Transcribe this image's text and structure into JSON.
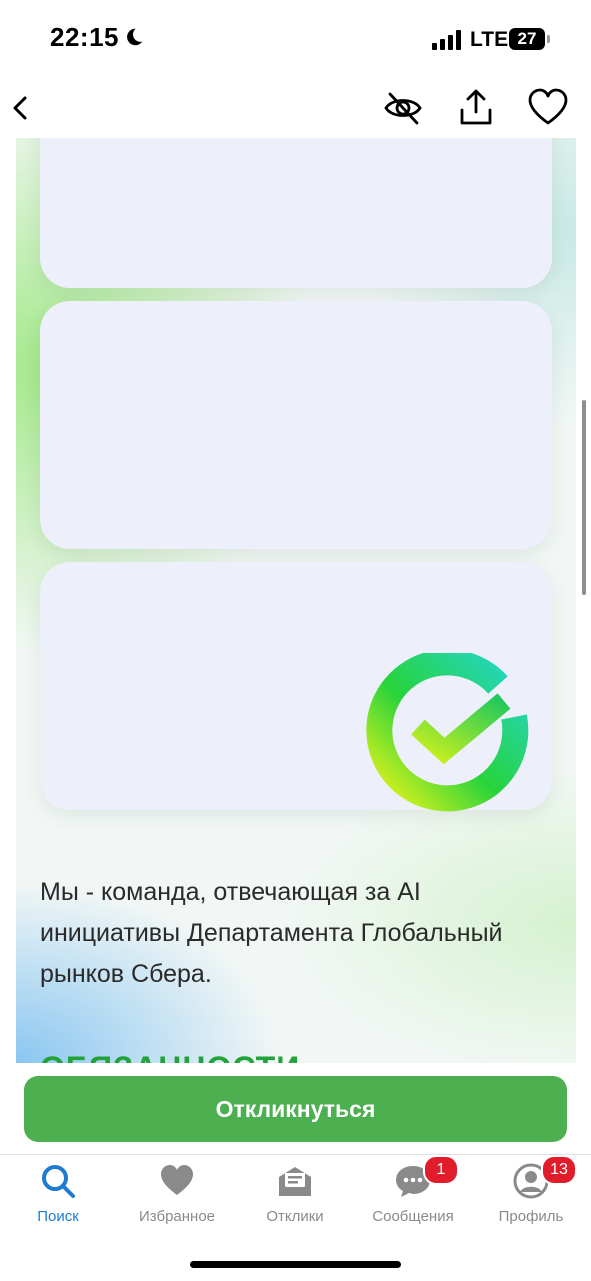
{
  "status_bar": {
    "time": "22:15",
    "network": "LTE",
    "battery": "27",
    "icons": [
      "moon-icon",
      "signal-icon",
      "battery-icon"
    ]
  },
  "nav_bar": {
    "icons": [
      "back-chevron-icon",
      "hide-eye-icon",
      "share-icon",
      "heart-icon"
    ]
  },
  "content": {
    "description": "Мы - команда, отвечающая за AI инициативы Департамента Глобальный рынков Сбера.",
    "next_heading": "ОБЯЗАННОСТИ",
    "logo_icon": "sber-logo-icon"
  },
  "apply_button": {
    "label": "Откликнуться"
  },
  "tab_bar": {
    "tabs": [
      {
        "label": "Поиск",
        "icon": "search-icon",
        "active": true,
        "badge": ""
      },
      {
        "label": "Избранное",
        "icon": "heart-icon",
        "active": false,
        "badge": ""
      },
      {
        "label": "Отклики",
        "icon": "responses-icon",
        "active": false,
        "badge": ""
      },
      {
        "label": "Сообщения",
        "icon": "messages-icon",
        "active": false,
        "badge": "1"
      },
      {
        "label": "Профиль",
        "icon": "profile-icon",
        "active": false,
        "badge": "13"
      }
    ]
  },
  "colors": {
    "accent_green": "#4caf50",
    "active_tab": "#1f7ad1",
    "badge_red": "#e21d2b",
    "panel": "#edf0fb"
  }
}
